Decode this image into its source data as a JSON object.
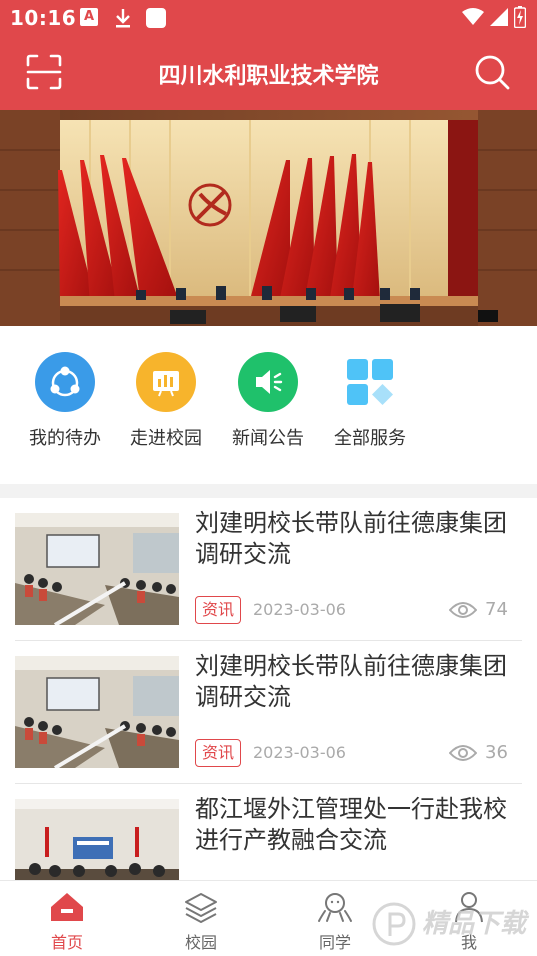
{
  "status_bar": {
    "time": "10:16",
    "a_badge": "A"
  },
  "header": {
    "title": "四川水利职业技术学院",
    "bg_color": "#e0484b"
  },
  "quick_menu": [
    {
      "label": "我的待办",
      "icon": "share-people-icon",
      "color": "#3a9be8"
    },
    {
      "label": "走进校园",
      "icon": "chart-board-icon",
      "color": "#f7b42c"
    },
    {
      "label": "新闻公告",
      "icon": "speaker-icon",
      "color": "#1fc16b"
    },
    {
      "label": "全部服务",
      "icon": "grid-icon",
      "color": "#4fc3f7"
    }
  ],
  "news": [
    {
      "title": "刘建明校长带队前往德康集团调研交流",
      "tag": "资讯",
      "date": "2023-03-06",
      "views": "74"
    },
    {
      "title": "刘建明校长带队前往德康集团调研交流",
      "tag": "资讯",
      "date": "2023-03-06",
      "views": "36"
    },
    {
      "title": "都江堰外江管理处一行赴我校 进行产教融合交流",
      "tag": "",
      "date": "",
      "views": ""
    }
  ],
  "tabs": [
    {
      "label": "首页",
      "icon": "home-icon",
      "active": true
    },
    {
      "label": "校园",
      "icon": "layers-icon",
      "active": false
    },
    {
      "label": "同学",
      "icon": "classmates-icon",
      "active": false
    },
    {
      "label": "我",
      "icon": "user-icon",
      "active": false
    }
  ],
  "watermark": "精品下载"
}
